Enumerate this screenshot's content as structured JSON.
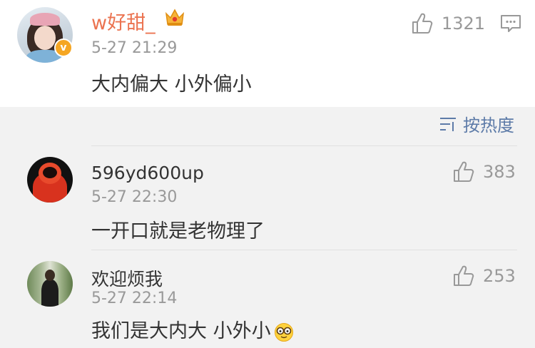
{
  "main_comment": {
    "username": "w好甜_",
    "time": "5-27 21:29",
    "text": "大内偏大 小外偏小",
    "likes": "1321",
    "verified_mark": "v"
  },
  "sort": {
    "label": "按热度"
  },
  "replies": [
    {
      "username": "596yd600up",
      "time": "5-27 22:30",
      "text": "一开口就是老物理了",
      "likes": "383"
    },
    {
      "username": "欢迎烦我",
      "time": "5-27 22:14",
      "text": "我们是大内大 小外小",
      "likes": "253",
      "emoji": "glasses-face-emoji"
    }
  ],
  "colors": {
    "username_accent": "#eb7350",
    "link_blue": "#5d7ba8",
    "meta_gray": "#999999"
  },
  "icons": [
    "thumbs-up-icon",
    "comment-icon",
    "sort-icon",
    "crown-badge-icon",
    "verified-icon"
  ]
}
